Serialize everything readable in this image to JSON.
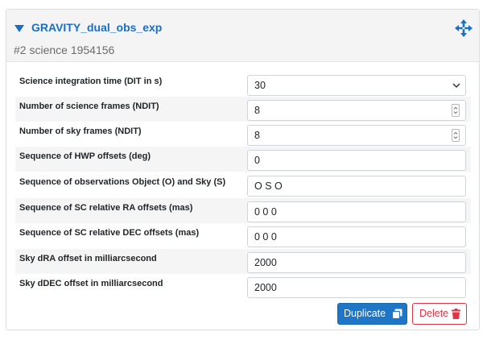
{
  "header": {
    "title": "GRAVITY_dual_obs_exp",
    "subtitle": "#2 science 1954156"
  },
  "fields": [
    {
      "label": "Science integration time (DIT in s)",
      "value": "30",
      "kind": "select"
    },
    {
      "label": "Number of science frames (NDIT)",
      "value": "8",
      "kind": "number"
    },
    {
      "label": "Number of sky frames (NDIT)",
      "value": "8",
      "kind": "number"
    },
    {
      "label": "Sequence of HWP offsets (deg)",
      "value": "0",
      "kind": "text"
    },
    {
      "label": "Sequence of observations Object (O) and Sky (S)",
      "value": "O S O",
      "kind": "text"
    },
    {
      "label": "Sequence of SC relative RA offsets (mas)",
      "value": "0 0 0",
      "kind": "text"
    },
    {
      "label": "Sequence of SC relative DEC offsets (mas)",
      "value": "0 0 0",
      "kind": "text"
    },
    {
      "label": "Sky dRA offset in milliarcsecond",
      "value": "2000",
      "kind": "text"
    },
    {
      "label": "Sky dDEC offset in milliarcsecond",
      "value": "2000",
      "kind": "text"
    }
  ],
  "actions": {
    "duplicate_label": "Duplicate",
    "delete_label": "Delete"
  },
  "colors": {
    "accent": "#1a6ec4",
    "primary_button": "#1f76c7",
    "danger": "#dc3545"
  },
  "icons": [
    "caret-down-icon",
    "move-arrows-icon",
    "chevron-down-icon",
    "spinner-icon",
    "copy-icon",
    "trash-icon"
  ]
}
